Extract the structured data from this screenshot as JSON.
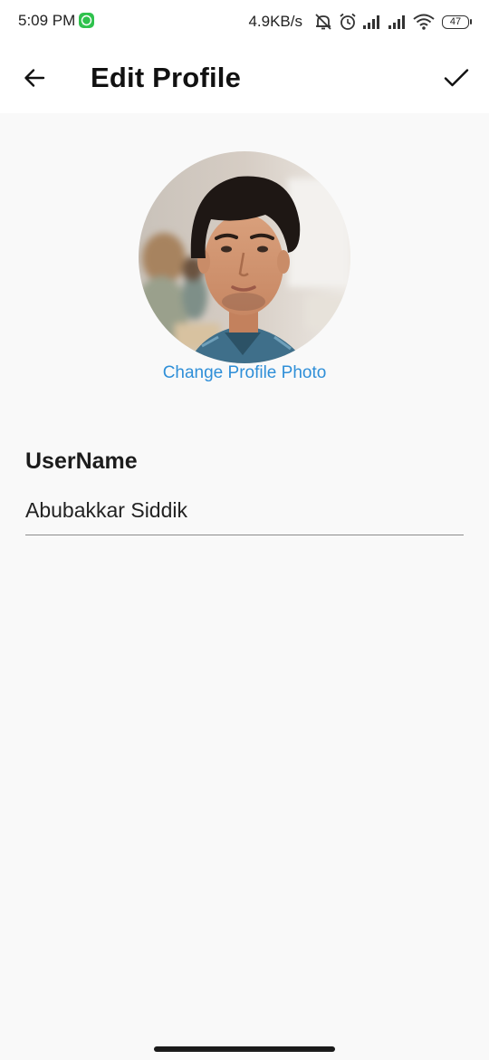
{
  "status_bar": {
    "time": "5:09 PM",
    "net_speed": "4.9KB/s",
    "battery_level": "47",
    "icons": [
      "whatsapp-icon",
      "mute-icon",
      "alarm-icon",
      "signal-icon",
      "signal-icon",
      "wifi-icon",
      "battery-icon"
    ]
  },
  "app_bar": {
    "title": "Edit Profile",
    "back_icon": "arrow-left-icon",
    "save_icon": "check-icon"
  },
  "profile": {
    "change_photo_label": "Change Profile Photo",
    "username_label": "UserName",
    "username_value": "Abubakkar Siddik"
  },
  "colors": {
    "accent": "#2f8fd8",
    "background": "#f9f9f9",
    "app_bar": "#ffffff",
    "whatsapp": "#2fc24d"
  }
}
